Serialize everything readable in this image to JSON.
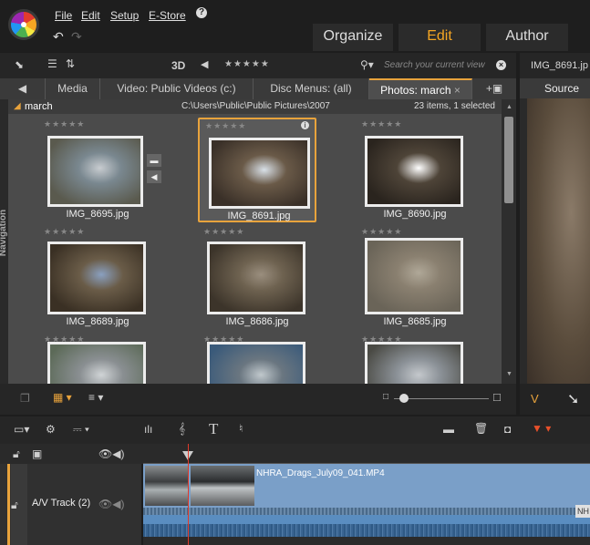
{
  "menu": [
    "File",
    "Edit",
    "Setup",
    "E-Store"
  ],
  "modes": {
    "organize": "Organize",
    "edit": "Edit",
    "author": "Author"
  },
  "library": {
    "toolbar_3d": "3D",
    "search_placeholder": "Search your current view",
    "tabs": [
      "Media",
      "Video: Public Videos (c:)",
      "Disc Menus: (all)",
      "Photos: march"
    ],
    "folder": "march",
    "path": "C:\\Users\\Public\\Public Pictures\\2007",
    "count": "23 items, 1 selected",
    "nav_label": "Navigation",
    "items": [
      {
        "name": "IMG_8695.jpg",
        "selected": false,
        "colors": [
          "#7a8890",
          "#5a5a4e",
          "#c8ccd0"
        ]
      },
      {
        "name": "IMG_8691.jpg",
        "selected": true,
        "colors": [
          "#6a5a48",
          "#3a3028",
          "#d8e0e8"
        ]
      },
      {
        "name": "IMG_8690.jpg",
        "selected": false,
        "colors": [
          "#4e4438",
          "#2a241e",
          "#ffffff"
        ]
      },
      {
        "name": "IMG_8689.jpg",
        "selected": false,
        "colors": [
          "#6a5c48",
          "#3a3024",
          "#8aa0c0"
        ]
      },
      {
        "name": "IMG_8686.jpg",
        "selected": false,
        "colors": [
          "#6e6250",
          "#3c342a",
          "#9a8e7e"
        ]
      },
      {
        "name": "IMG_8685.jpg",
        "selected": false,
        "colors": [
          "#8a8070",
          "#6a6458",
          "#b0a898"
        ]
      },
      {
        "name": "",
        "selected": false,
        "colors": [
          "#8a8f92",
          "#5c6a58",
          "#d0d4d6"
        ]
      },
      {
        "name": "",
        "selected": false,
        "colors": [
          "#6a7680",
          "#3a5a7a",
          "#c0c8cc"
        ]
      },
      {
        "name": "",
        "selected": false,
        "colors": [
          "#8c9298",
          "#4a4a44",
          "#c4c8cc"
        ]
      }
    ]
  },
  "preview": {
    "title": "IMG_8691.jp",
    "source_tab": "Source"
  },
  "timeline": {
    "track_name": "A/V Track (2)",
    "clip_name": "NHRA_Drags_July09_041.MP4",
    "clip_tail": "NH"
  },
  "accent": "#e8a33c",
  "clip_color": "#7a9fc8"
}
